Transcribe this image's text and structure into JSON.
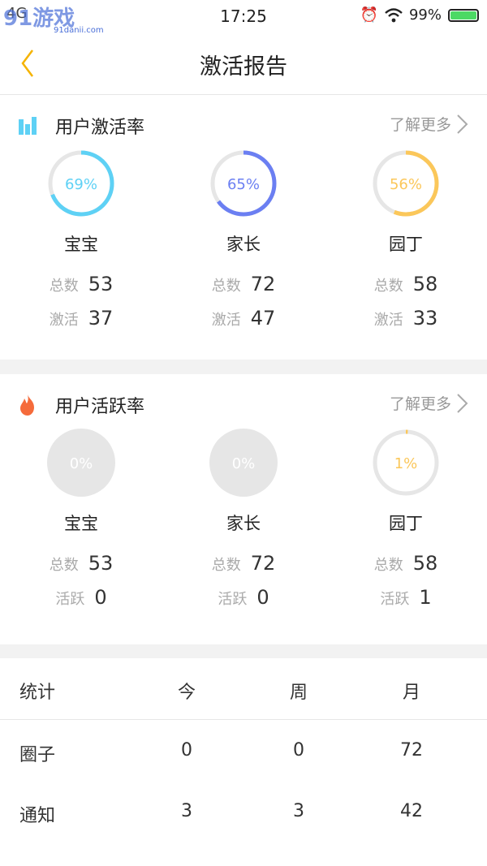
{
  "status_bar": {
    "network": "4G",
    "time": "17:25",
    "battery": "99%"
  },
  "watermark": {
    "brand": "91游戏",
    "site": "91danji.com"
  },
  "nav": {
    "title": "激活报告"
  },
  "activation": {
    "title": "用户激活率",
    "more": "了解更多",
    "columns": [
      {
        "pct_label": "69%",
        "pct": 69,
        "color": "#5ed1f5",
        "name": "宝宝",
        "total_label": "总数",
        "total": "53",
        "sub_label": "激活",
        "sub": "37"
      },
      {
        "pct_label": "65%",
        "pct": 65,
        "color": "#6b7ff2",
        "name": "家长",
        "total_label": "总数",
        "total": "72",
        "sub_label": "激活",
        "sub": "47"
      },
      {
        "pct_label": "56%",
        "pct": 56,
        "color": "#fbc75a",
        "name": "园丁",
        "total_label": "总数",
        "total": "58",
        "sub_label": "激活",
        "sub": "33"
      }
    ]
  },
  "active": {
    "title": "用户活跃率",
    "more": "了解更多",
    "columns": [
      {
        "pct_label": "0%",
        "pct": 0,
        "color": "#dddddd",
        "name": "宝宝",
        "total_label": "总数",
        "total": "53",
        "sub_label": "活跃",
        "sub": "0"
      },
      {
        "pct_label": "0%",
        "pct": 0,
        "color": "#dddddd",
        "name": "家长",
        "total_label": "总数",
        "total": "72",
        "sub_label": "活跃",
        "sub": "0"
      },
      {
        "pct_label": "1%",
        "pct": 1,
        "color": "#fbc75a",
        "name": "园丁",
        "total_label": "总数",
        "total": "58",
        "sub_label": "活跃",
        "sub": "1"
      }
    ]
  },
  "stats": {
    "headers": [
      "统计",
      "今",
      "周",
      "月"
    ],
    "rows": [
      [
        "圈子",
        "0",
        "0",
        "72"
      ],
      [
        "通知",
        "3",
        "3",
        "42"
      ]
    ]
  },
  "colors": {
    "accent_back": "#f5b300",
    "fire": "#f56b3b",
    "chart_icon": "#5ed1f5"
  }
}
